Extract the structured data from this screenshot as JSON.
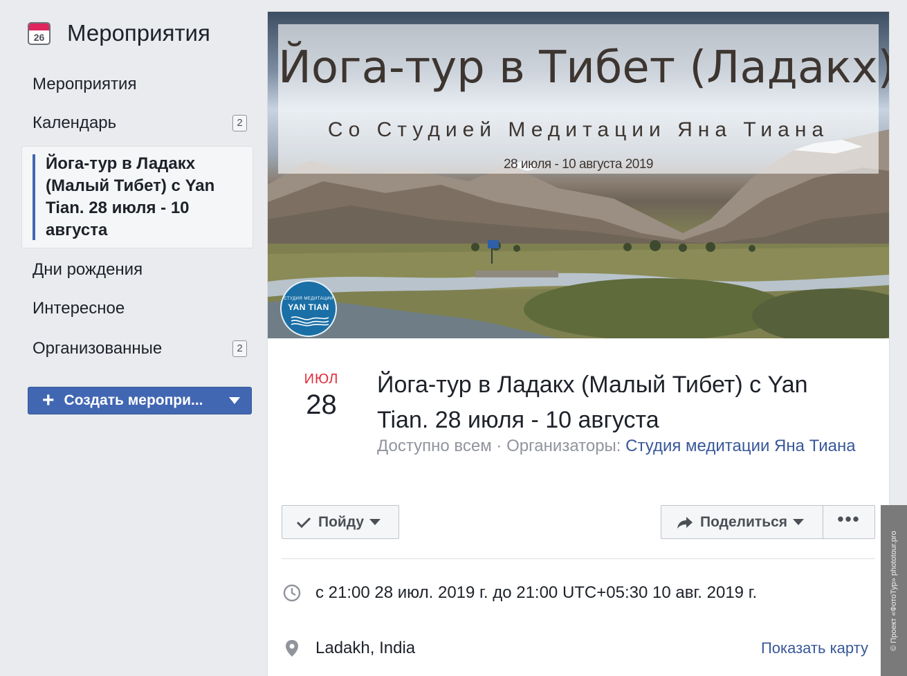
{
  "sidebar": {
    "title": "Мероприятия",
    "calendar_icon_day": "26",
    "items": [
      {
        "label": "Мероприятия",
        "badge": ""
      },
      {
        "label": "Календарь",
        "badge": "2"
      },
      {
        "label": "Дни рождения",
        "badge": ""
      },
      {
        "label": "Интересное",
        "badge": ""
      },
      {
        "label": "Организованные",
        "badge": "2"
      }
    ],
    "active_item": "Йога-тур в Ладакх (Малый Тибет) с Yan Tian. 28 июля - 10 августа",
    "create_button": "Создать меропри..."
  },
  "cover": {
    "title": "Йога-тур в Тибет (Ладакх)",
    "subtitle": "Со Студией Медитации Яна Тиана",
    "dates": "28 июля - 10 августа 2019",
    "logo_small": "СТУДИЯ МЕДИТАЦИИ",
    "logo_big": "YAN TIAN"
  },
  "event": {
    "month": "ИЮЛ",
    "day": "28",
    "title": "Йога-тур в Ладакх (Малый Тибет) с Yan Tian. 28 июля - 10 августа",
    "privacy": "Доступно всем",
    "separator": " · ",
    "organizers_label": "Организаторы:",
    "organizer": "Студия медитации Яна Тиана",
    "go_button": "Пойду",
    "share_button": "Поделиться",
    "more_button": "•••",
    "time": "с 21:00 28 июл. 2019 г. до 21:00 UTC+05:30 10 авг. 2019 г.",
    "location": "Ladakh, India",
    "map_link": "Показать карту"
  },
  "watermark": "© Проект «ФотоТур» phototour.pro",
  "colors": {
    "accent": "#4267b2",
    "link": "#385898",
    "date_month": "#e02d3c",
    "page_bg": "#e9ebee"
  }
}
